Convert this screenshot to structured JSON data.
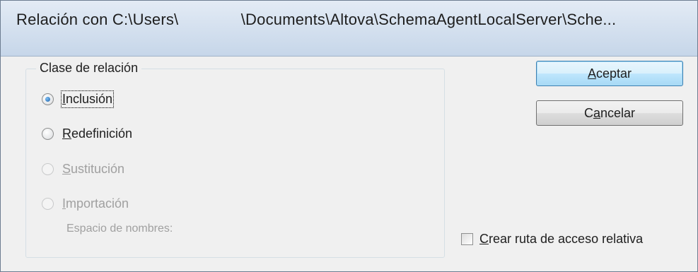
{
  "window": {
    "title": "Relación con C:\\Users\\              \\Documents\\Altova\\SchemaAgentLocalServer\\Sche..."
  },
  "group": {
    "legend": "Clase de relación"
  },
  "options": [
    {
      "mnemonic": "I",
      "rest": "nclusión",
      "checked": true,
      "enabled": true
    },
    {
      "mnemonic": "R",
      "rest": "edefinición",
      "checked": false,
      "enabled": true
    },
    {
      "mnemonic": "S",
      "rest": "ustitución",
      "checked": false,
      "enabled": false
    },
    {
      "mnemonic": "I",
      "rest": "mportación",
      "checked": false,
      "enabled": false
    }
  ],
  "namespace_label": "Espacio de nombres:",
  "buttons": {
    "ok": {
      "mnemonic": "A",
      "rest": "ceptar"
    },
    "cancel": {
      "pre": "C",
      "mnemonic": "a",
      "rest": "ncelar"
    }
  },
  "checkbox": {
    "mnemonic": "C",
    "rest": "rear ruta de acceso relativa",
    "checked": false
  }
}
